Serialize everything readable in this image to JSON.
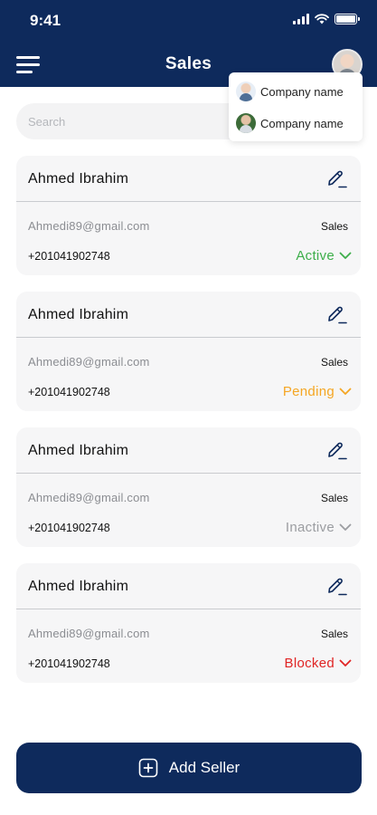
{
  "status_bar": {
    "time": "9:41"
  },
  "header": {
    "title": "Sales"
  },
  "search": {
    "placeholder": "Search"
  },
  "company_menu": {
    "items": [
      {
        "label": "Company name"
      },
      {
        "label": "Company name"
      }
    ]
  },
  "sellers": [
    {
      "name": "Ahmed Ibrahim",
      "email": "Ahmedi89@gmail.com",
      "role": "Sales",
      "phone": "+201041902748",
      "status": "Active",
      "status_color": "#3dae4a"
    },
    {
      "name": "Ahmed Ibrahim",
      "email": "Ahmedi89@gmail.com",
      "role": "Sales",
      "phone": "+201041902748",
      "status": "Pending",
      "status_color": "#f5a623"
    },
    {
      "name": "Ahmed Ibrahim",
      "email": "Ahmedi89@gmail.com",
      "role": "Sales",
      "phone": "+201041902748",
      "status": "Inactive",
      "status_color": "#9b9da1"
    },
    {
      "name": "Ahmed Ibrahim",
      "email": "Ahmedi89@gmail.com",
      "role": "Sales",
      "phone": "+201041902748",
      "status": "Blocked",
      "status_color": "#e02424"
    }
  ],
  "actions": {
    "add_seller_label": "Add Seller"
  },
  "colors": {
    "primary": "#0e2a5c",
    "card_background": "#f6f6f7"
  }
}
